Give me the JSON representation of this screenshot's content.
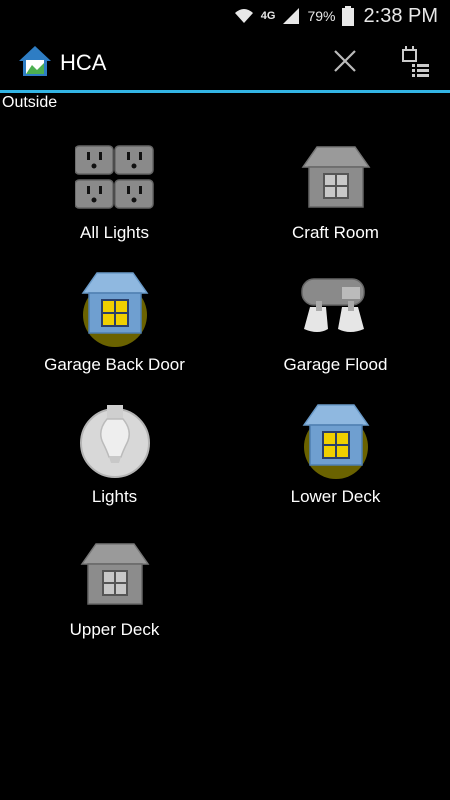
{
  "status_bar": {
    "network": "4G",
    "battery": "79%",
    "time": "2:38 PM"
  },
  "action_bar": {
    "title": "HCA"
  },
  "section": {
    "label": "Outside"
  },
  "tiles": [
    {
      "label": "All Lights",
      "icon": "outlets-icon"
    },
    {
      "label": "Craft Room",
      "icon": "house-dark-icon"
    },
    {
      "label": "Garage Back Door",
      "icon": "house-lit-icon"
    },
    {
      "label": "Garage Flood",
      "icon": "floodlight-icon"
    },
    {
      "label": "Lights",
      "icon": "bulb-icon"
    },
    {
      "label": "Lower Deck",
      "icon": "house-lit-icon"
    },
    {
      "label": "Upper Deck",
      "icon": "house-dark-icon"
    }
  ],
  "colors": {
    "accent": "#33b5e5",
    "background": "#000000",
    "lit": "#f0d000"
  }
}
